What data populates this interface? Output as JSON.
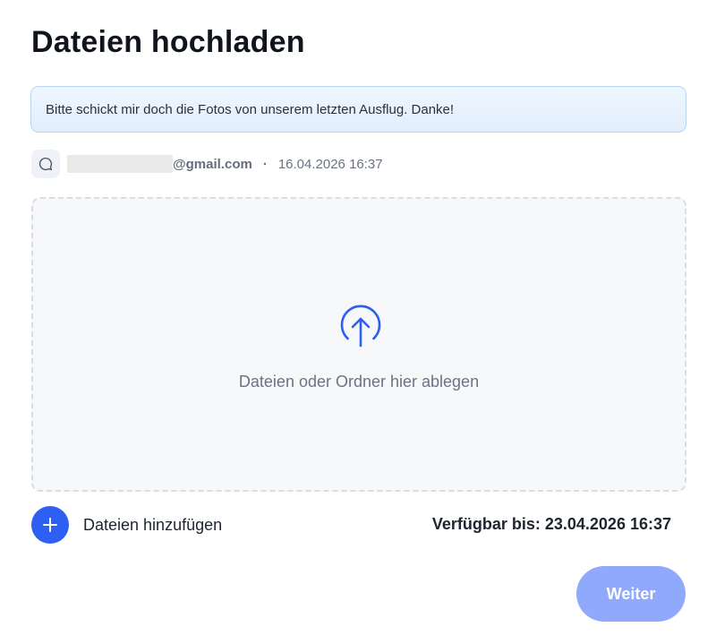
{
  "page": {
    "title": "Dateien hochladen"
  },
  "message": {
    "text": "Bitte schickt mir doch die Fotos von unserem letzten Ausflug. Danke!"
  },
  "sender": {
    "email_domain": "@gmail.com",
    "separator": "·",
    "datetime": "16.04.2026 16:37",
    "icon": "comment-icon"
  },
  "dropzone": {
    "icon": "upload-arrow-icon",
    "text": "Dateien oder Ordner hier ablegen"
  },
  "actions": {
    "add_files_label": "Dateien hinzufügen",
    "add_icon": "plus-icon",
    "available_until": "Verfügbar bis: 23.04.2026 16:37",
    "next_label": "Weiter"
  },
  "colors": {
    "accent": "#2c5ff2",
    "button_disabled": "#90a9fb",
    "message_bg": "#e8f2fd",
    "dropzone_bg": "#f7f8fa"
  }
}
